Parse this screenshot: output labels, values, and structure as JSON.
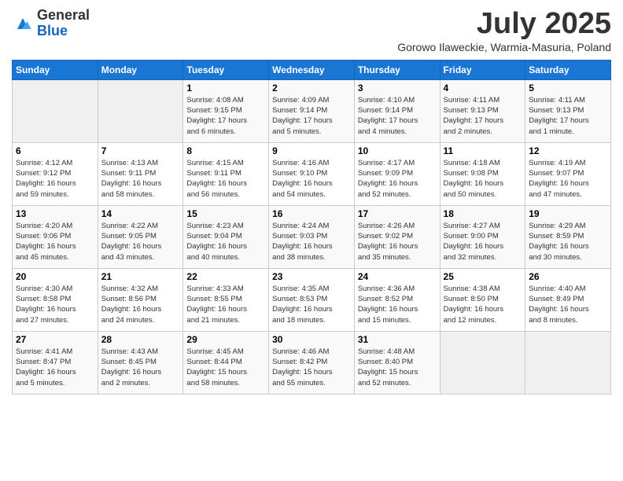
{
  "header": {
    "logo_general": "General",
    "logo_blue": "Blue",
    "month_title": "July 2025",
    "subtitle": "Gorowo Ilaweckie, Warmia-Masuria, Poland"
  },
  "days_of_week": [
    "Sunday",
    "Monday",
    "Tuesday",
    "Wednesday",
    "Thursday",
    "Friday",
    "Saturday"
  ],
  "weeks": [
    [
      {
        "day": "",
        "info": ""
      },
      {
        "day": "",
        "info": ""
      },
      {
        "day": "1",
        "info": "Sunrise: 4:08 AM\nSunset: 9:15 PM\nDaylight: 17 hours\nand 6 minutes."
      },
      {
        "day": "2",
        "info": "Sunrise: 4:09 AM\nSunset: 9:14 PM\nDaylight: 17 hours\nand 5 minutes."
      },
      {
        "day": "3",
        "info": "Sunrise: 4:10 AM\nSunset: 9:14 PM\nDaylight: 17 hours\nand 4 minutes."
      },
      {
        "day": "4",
        "info": "Sunrise: 4:11 AM\nSunset: 9:13 PM\nDaylight: 17 hours\nand 2 minutes."
      },
      {
        "day": "5",
        "info": "Sunrise: 4:11 AM\nSunset: 9:13 PM\nDaylight: 17 hours\nand 1 minute."
      }
    ],
    [
      {
        "day": "6",
        "info": "Sunrise: 4:12 AM\nSunset: 9:12 PM\nDaylight: 16 hours\nand 59 minutes."
      },
      {
        "day": "7",
        "info": "Sunrise: 4:13 AM\nSunset: 9:11 PM\nDaylight: 16 hours\nand 58 minutes."
      },
      {
        "day": "8",
        "info": "Sunrise: 4:15 AM\nSunset: 9:11 PM\nDaylight: 16 hours\nand 56 minutes."
      },
      {
        "day": "9",
        "info": "Sunrise: 4:16 AM\nSunset: 9:10 PM\nDaylight: 16 hours\nand 54 minutes."
      },
      {
        "day": "10",
        "info": "Sunrise: 4:17 AM\nSunset: 9:09 PM\nDaylight: 16 hours\nand 52 minutes."
      },
      {
        "day": "11",
        "info": "Sunrise: 4:18 AM\nSunset: 9:08 PM\nDaylight: 16 hours\nand 50 minutes."
      },
      {
        "day": "12",
        "info": "Sunrise: 4:19 AM\nSunset: 9:07 PM\nDaylight: 16 hours\nand 47 minutes."
      }
    ],
    [
      {
        "day": "13",
        "info": "Sunrise: 4:20 AM\nSunset: 9:06 PM\nDaylight: 16 hours\nand 45 minutes."
      },
      {
        "day": "14",
        "info": "Sunrise: 4:22 AM\nSunset: 9:05 PM\nDaylight: 16 hours\nand 43 minutes."
      },
      {
        "day": "15",
        "info": "Sunrise: 4:23 AM\nSunset: 9:04 PM\nDaylight: 16 hours\nand 40 minutes."
      },
      {
        "day": "16",
        "info": "Sunrise: 4:24 AM\nSunset: 9:03 PM\nDaylight: 16 hours\nand 38 minutes."
      },
      {
        "day": "17",
        "info": "Sunrise: 4:26 AM\nSunset: 9:02 PM\nDaylight: 16 hours\nand 35 minutes."
      },
      {
        "day": "18",
        "info": "Sunrise: 4:27 AM\nSunset: 9:00 PM\nDaylight: 16 hours\nand 32 minutes."
      },
      {
        "day": "19",
        "info": "Sunrise: 4:29 AM\nSunset: 8:59 PM\nDaylight: 16 hours\nand 30 minutes."
      }
    ],
    [
      {
        "day": "20",
        "info": "Sunrise: 4:30 AM\nSunset: 8:58 PM\nDaylight: 16 hours\nand 27 minutes."
      },
      {
        "day": "21",
        "info": "Sunrise: 4:32 AM\nSunset: 8:56 PM\nDaylight: 16 hours\nand 24 minutes."
      },
      {
        "day": "22",
        "info": "Sunrise: 4:33 AM\nSunset: 8:55 PM\nDaylight: 16 hours\nand 21 minutes."
      },
      {
        "day": "23",
        "info": "Sunrise: 4:35 AM\nSunset: 8:53 PM\nDaylight: 16 hours\nand 18 minutes."
      },
      {
        "day": "24",
        "info": "Sunrise: 4:36 AM\nSunset: 8:52 PM\nDaylight: 16 hours\nand 15 minutes."
      },
      {
        "day": "25",
        "info": "Sunrise: 4:38 AM\nSunset: 8:50 PM\nDaylight: 16 hours\nand 12 minutes."
      },
      {
        "day": "26",
        "info": "Sunrise: 4:40 AM\nSunset: 8:49 PM\nDaylight: 16 hours\nand 8 minutes."
      }
    ],
    [
      {
        "day": "27",
        "info": "Sunrise: 4:41 AM\nSunset: 8:47 PM\nDaylight: 16 hours\nand 5 minutes."
      },
      {
        "day": "28",
        "info": "Sunrise: 4:43 AM\nSunset: 8:45 PM\nDaylight: 16 hours\nand 2 minutes."
      },
      {
        "day": "29",
        "info": "Sunrise: 4:45 AM\nSunset: 8:44 PM\nDaylight: 15 hours\nand 58 minutes."
      },
      {
        "day": "30",
        "info": "Sunrise: 4:46 AM\nSunset: 8:42 PM\nDaylight: 15 hours\nand 55 minutes."
      },
      {
        "day": "31",
        "info": "Sunrise: 4:48 AM\nSunset: 8:40 PM\nDaylight: 15 hours\nand 52 minutes."
      },
      {
        "day": "",
        "info": ""
      },
      {
        "day": "",
        "info": ""
      }
    ]
  ]
}
